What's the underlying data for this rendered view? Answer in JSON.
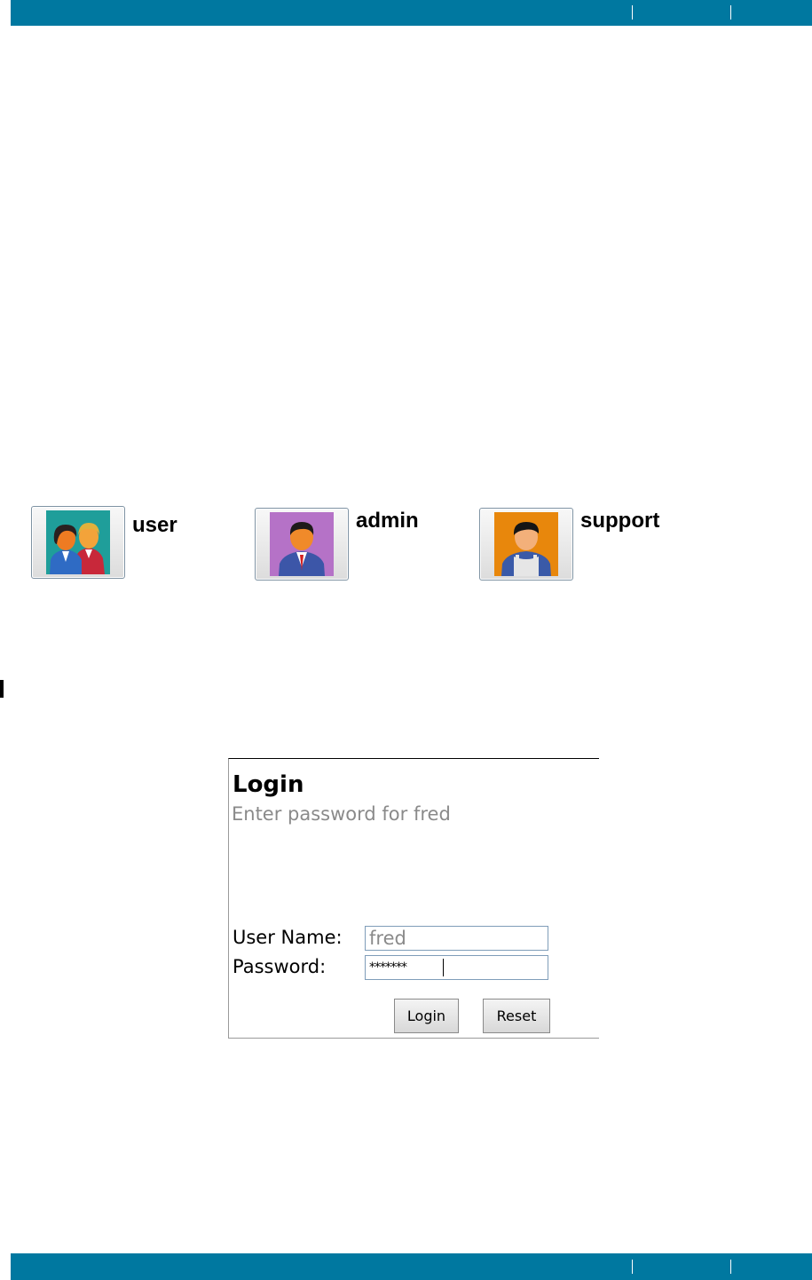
{
  "roles": [
    {
      "label": "user",
      "icon": "two-users-icon",
      "color": "#1f9e9a"
    },
    {
      "label": "admin",
      "icon": "businessman-icon",
      "color": "#b572c7"
    },
    {
      "label": "support",
      "icon": "technician-icon",
      "color": "#e8870c"
    }
  ],
  "login": {
    "title": "Login",
    "subtitle": "Enter password for fred",
    "username_label": "User Name:",
    "username_value": "fred",
    "password_label": "Password:",
    "password_value": "*******",
    "login_button": "Login",
    "reset_button": "Reset"
  },
  "colors": {
    "band": "#0078a0",
    "subtitle": "#8a8a8a"
  }
}
